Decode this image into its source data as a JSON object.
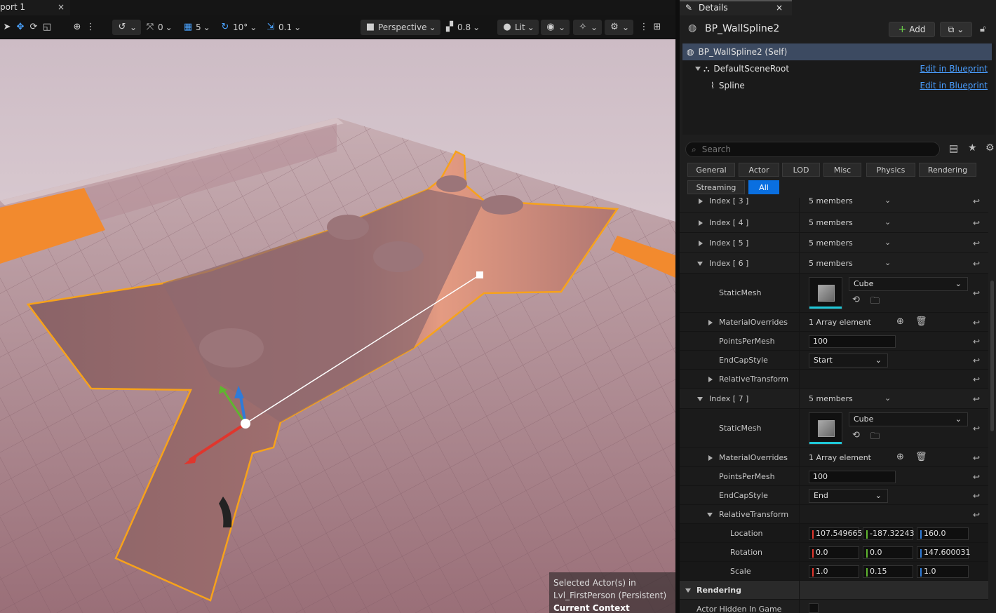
{
  "viewport": {
    "tab_label": "port 1",
    "tab_close": "×",
    "toolbar": {
      "surface_snap_value": "0",
      "grid_snap_value": "5",
      "rotation_snap_value": "10°",
      "scale_snap_value": "0.1",
      "view_mode_label": "Perspective",
      "camera_speed_value": "0.8",
      "lighting_label": "Lit"
    },
    "selection_info": {
      "line1": "Selected Actor(s) in",
      "line2": "Lvl_FirstPerson (Persistent)",
      "context": "Current Context"
    }
  },
  "details": {
    "tab_label": "Details",
    "tab_close": "×",
    "title": "BP_WallSpline2",
    "add_label": "Add",
    "components": [
      {
        "label": "BP_WallSpline2 (Self)",
        "link": ""
      },
      {
        "label": "DefaultSceneRoot",
        "link": "Edit in Blueprint"
      },
      {
        "label": "Spline",
        "link": "Edit in Blueprint"
      }
    ],
    "search_placeholder": "Search",
    "filters_row1": [
      "General",
      "Actor",
      "LOD",
      "Misc",
      "Physics",
      "Rendering"
    ],
    "filters_row2": [
      "Streaming",
      "All"
    ],
    "properties": {
      "index3": {
        "name": "Index [ 3 ]",
        "value": "5 members"
      },
      "index4": {
        "name": "Index [ 4 ]",
        "value": "5 members"
      },
      "index5": {
        "name": "Index [ 5 ]",
        "value": "5 members"
      },
      "index6": {
        "name": "Index [ 6 ]",
        "value": "5 members"
      },
      "i6_static_mesh": {
        "name": "StaticMesh",
        "value": "Cube"
      },
      "i6_material_overrides": {
        "name": "MaterialOverrides",
        "value": "1 Array element"
      },
      "i6_points_per_mesh": {
        "name": "PointsPerMesh",
        "value": "100"
      },
      "i6_end_cap_style": {
        "name": "EndCapStyle",
        "value": "Start"
      },
      "i6_relative_transform": {
        "name": "RelativeTransform"
      },
      "index7": {
        "name": "Index [ 7 ]",
        "value": "5 members"
      },
      "i7_static_mesh": {
        "name": "StaticMesh",
        "value": "Cube"
      },
      "i7_material_overrides": {
        "name": "MaterialOverrides",
        "value": "1 Array element"
      },
      "i7_points_per_mesh": {
        "name": "PointsPerMesh",
        "value": "100"
      },
      "i7_end_cap_style": {
        "name": "EndCapStyle",
        "value": "End"
      },
      "i7_relative_transform": {
        "name": "RelativeTransform"
      },
      "location": {
        "name": "Location",
        "x": "107.549665",
        "y": "-187.32243",
        "z": "160.0"
      },
      "rotation": {
        "name": "Rotation",
        "x": "0.0",
        "y": "0.0",
        "z": "147.600031"
      },
      "scale": {
        "name": "Scale",
        "x": "1.0",
        "y": "0.15",
        "z": "1.0"
      },
      "rendering_section": "Rendering",
      "actor_hidden": {
        "name": "Actor Hidden In Game"
      }
    },
    "colors": {
      "accent": "#0a6fe0",
      "link": "#4a9eff",
      "x_axis": "#e0362d",
      "y_axis": "#5fb530",
      "z_axis": "#2f7bd8",
      "selection_outline": "#f7a21b"
    }
  }
}
